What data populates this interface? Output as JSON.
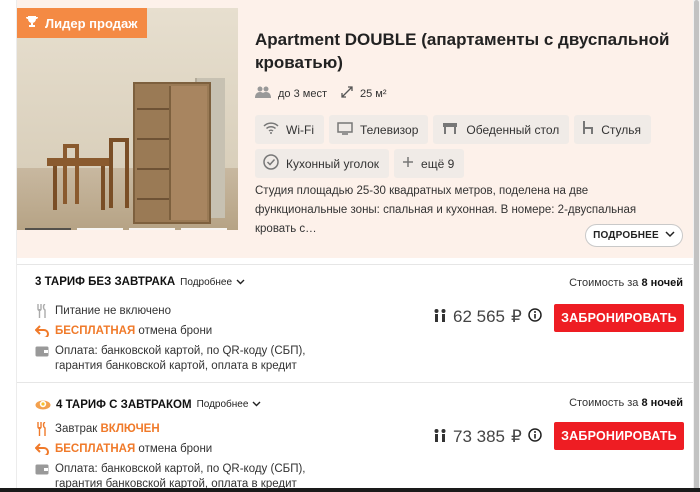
{
  "badge": {
    "label": "Лидер продаж",
    "icon": "trophy-icon"
  },
  "room": {
    "title": "Apartment DOUBLE (апартаменты с двуспальной кроватью)",
    "guests": "до 3 мест",
    "area": "25 м²",
    "amenities": [
      {
        "label": "Wi-Fi",
        "icon": "wifi-icon"
      },
      {
        "label": "Телевизор",
        "icon": "tv-icon"
      },
      {
        "label": "Обеденный стол",
        "icon": "table-icon"
      },
      {
        "label": "Стулья",
        "icon": "chair-icon"
      },
      {
        "label": "Кухонный уголок",
        "icon": "check-circle-icon"
      },
      {
        "label": "ещё 9",
        "icon": "plus-icon"
      }
    ],
    "description": "Студия площадью 25-30 квадратных метров, поделена на две функциональные зоны: спальная и кухонная. В номере: 2-двуспальная кровать с…",
    "more_label": "ПОДРОБНЕЕ"
  },
  "tariffs": [
    {
      "name": "3 ТАРИФ БЕЗ ЗАВТРАКА",
      "details_label": "Подробнее",
      "stay_prefix": "Стоимость за",
      "stay_nights": "8 ночей",
      "meal": "Питание не включено",
      "cancel_free": "БЕСПЛАТНАЯ",
      "cancel_rest": "отмена брони",
      "payment": "Оплата: банковской картой, по QR-коду (СБП), гарантия банковской картой, оплата в кредит",
      "price": "62 565",
      "currency": "₽",
      "book_label": "ЗАБРОНИРОВАТЬ"
    },
    {
      "name": "4 ТАРИФ С ЗАВТРАКОМ",
      "details_label": "Подробнее",
      "stay_prefix": "Стоимость за",
      "stay_nights": "8 ночей",
      "meal_prefix": "Завтрак",
      "meal_highlight": "ВКЛЮЧЕН",
      "cancel_free": "БЕСПЛАТНАЯ",
      "cancel_rest": "отмена брони",
      "payment": "Оплата: банковской картой, по QR-коду (СБП), гарантия банковской картой, оплата в кредит",
      "price": "73 385",
      "currency": "₽",
      "book_label": "ЗАБРОНИРОВАТЬ"
    }
  ],
  "colors": {
    "accent": "#f07a2a",
    "book": "#ee1d23",
    "badge": "#f48a44",
    "header_bg": "#fdf1ea"
  }
}
